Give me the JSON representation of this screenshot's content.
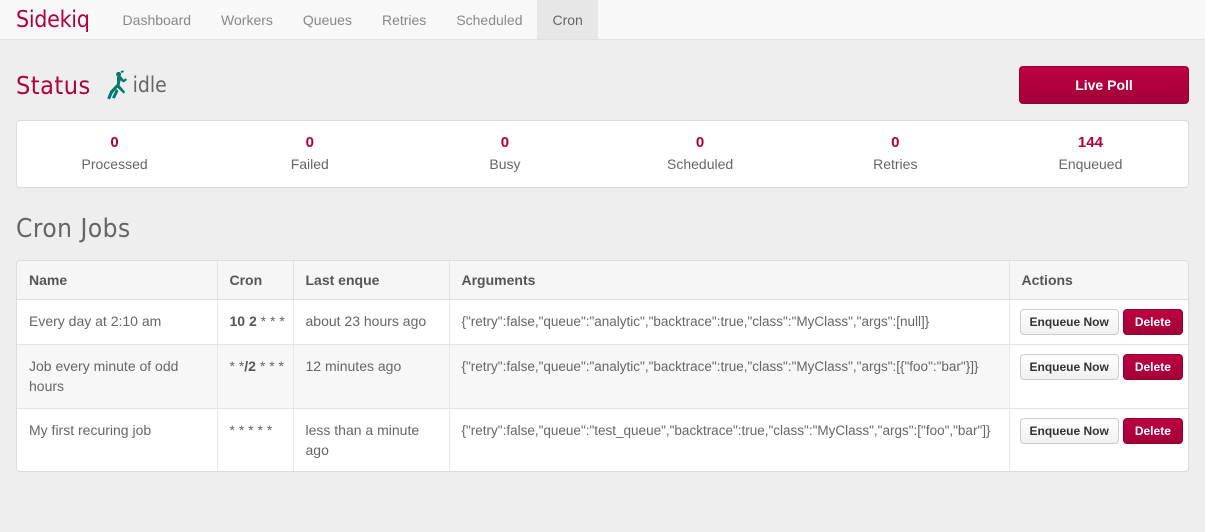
{
  "navbar": {
    "brand": "Sidekiq",
    "items": [
      {
        "label": "Dashboard",
        "active": false
      },
      {
        "label": "Workers",
        "active": false
      },
      {
        "label": "Queues",
        "active": false
      },
      {
        "label": "Retries",
        "active": false
      },
      {
        "label": "Scheduled",
        "active": false
      },
      {
        "label": "Cron",
        "active": true
      }
    ]
  },
  "status": {
    "label": "Status",
    "icon": "sidekiq-person-icon",
    "icon_color": "#00796b",
    "text": "idle"
  },
  "live_poll": {
    "label": "Live Poll"
  },
  "stats": [
    {
      "value": "0",
      "label": "Processed"
    },
    {
      "value": "0",
      "label": "Failed"
    },
    {
      "value": "0",
      "label": "Busy"
    },
    {
      "value": "0",
      "label": "Scheduled"
    },
    {
      "value": "0",
      "label": "Retries"
    },
    {
      "value": "144",
      "label": "Enqueued"
    }
  ],
  "section": {
    "title": "Cron Jobs"
  },
  "table": {
    "headers": [
      "Name",
      "Cron",
      "Last enque",
      "Arguments",
      "Actions"
    ],
    "rows": [
      {
        "name": "Every day at 2:10 am",
        "cron_bold": "10 2",
        "cron_rest": " * * *",
        "last_enqueue": "about 23 hours ago",
        "arguments": "{\"retry\":false,\"queue\":\"analytic\",\"backtrace\":true,\"class\":\"MyClass\",\"args\":[null]}",
        "enqueue_label": "Enqueue Now",
        "delete_label": "Delete"
      },
      {
        "name": "Job every minute of odd hours",
        "cron_pre": "* *",
        "cron_bold": "/2",
        "cron_rest": " * * *",
        "last_enqueue": "12 minutes ago",
        "arguments": "{\"retry\":false,\"queue\":\"analytic\",\"backtrace\":true,\"class\":\"MyClass\",\"args\":[{\"foo\":\"bar\"}]}",
        "enqueue_label": "Enqueue Now",
        "delete_label": "Delete"
      },
      {
        "name": "My first recuring job",
        "cron_bold": "",
        "cron_rest": "* * * * *",
        "last_enqueue": "less than a minute ago",
        "arguments": "{\"retry\":false,\"queue\":\"test_queue\",\"backtrace\":true,\"class\":\"MyClass\",\"args\":[\"foo\",\"bar\"]}",
        "enqueue_label": "Enqueue Now",
        "delete_label": "Delete"
      }
    ]
  },
  "colors": {
    "brand": "#b1003e",
    "status_icon": "#00796b",
    "page_background": "#eeeeee"
  }
}
